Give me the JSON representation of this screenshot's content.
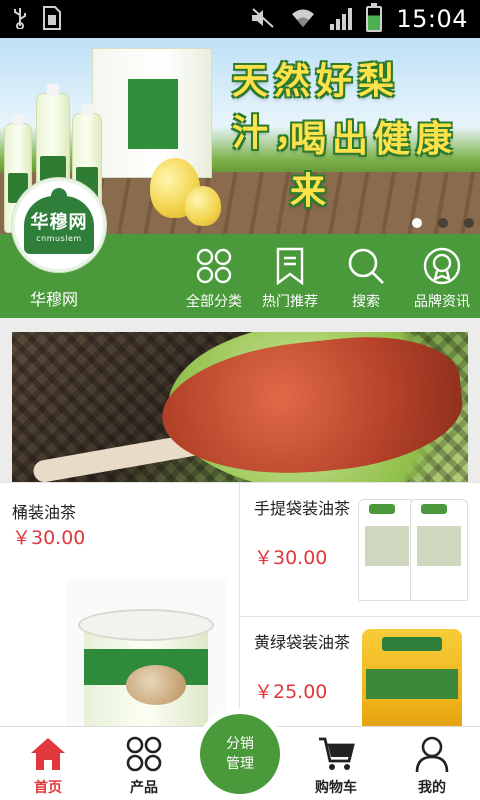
{
  "status_bar": {
    "time": "15:04",
    "icons": [
      "usb-icon",
      "sim-icon",
      "mute-icon",
      "wifi-icon",
      "signal-icon",
      "battery-charging-icon"
    ]
  },
  "banner": {
    "headline_1": "天然好梨汁，",
    "headline_2": "喝出健康来",
    "slides": 3,
    "active_slide": 0
  },
  "brand": {
    "logo_text": "华穆网",
    "logo_sub": "cnmuslem",
    "name": "华穆网",
    "color": "#4a9a3c"
  },
  "quick_nav": [
    {
      "label": "全部分类",
      "icon": "category-grid-icon"
    },
    {
      "label": "热门推荐",
      "icon": "bookmark-icon"
    },
    {
      "label": "搜索",
      "icon": "search-icon"
    },
    {
      "label": "品牌资讯",
      "icon": "brand-badge-icon"
    }
  ],
  "products": [
    {
      "name": "桶装油茶",
      "price": "￥30.00"
    },
    {
      "name": "手提袋装油茶",
      "price": "￥30.00"
    },
    {
      "name": "黄绿袋装油茶",
      "price": "￥25.00"
    }
  ],
  "price_color": "#e0383d",
  "bottom_nav": {
    "items": [
      {
        "label": "首页",
        "icon": "home-icon",
        "active": true
      },
      {
        "label": "产品",
        "icon": "grid-icon",
        "active": false
      },
      {
        "label": "购物车",
        "icon": "cart-icon",
        "active": false
      },
      {
        "label": "我的",
        "icon": "user-icon",
        "active": false
      }
    ],
    "center": {
      "line1": "分销",
      "line2": "管理"
    }
  }
}
